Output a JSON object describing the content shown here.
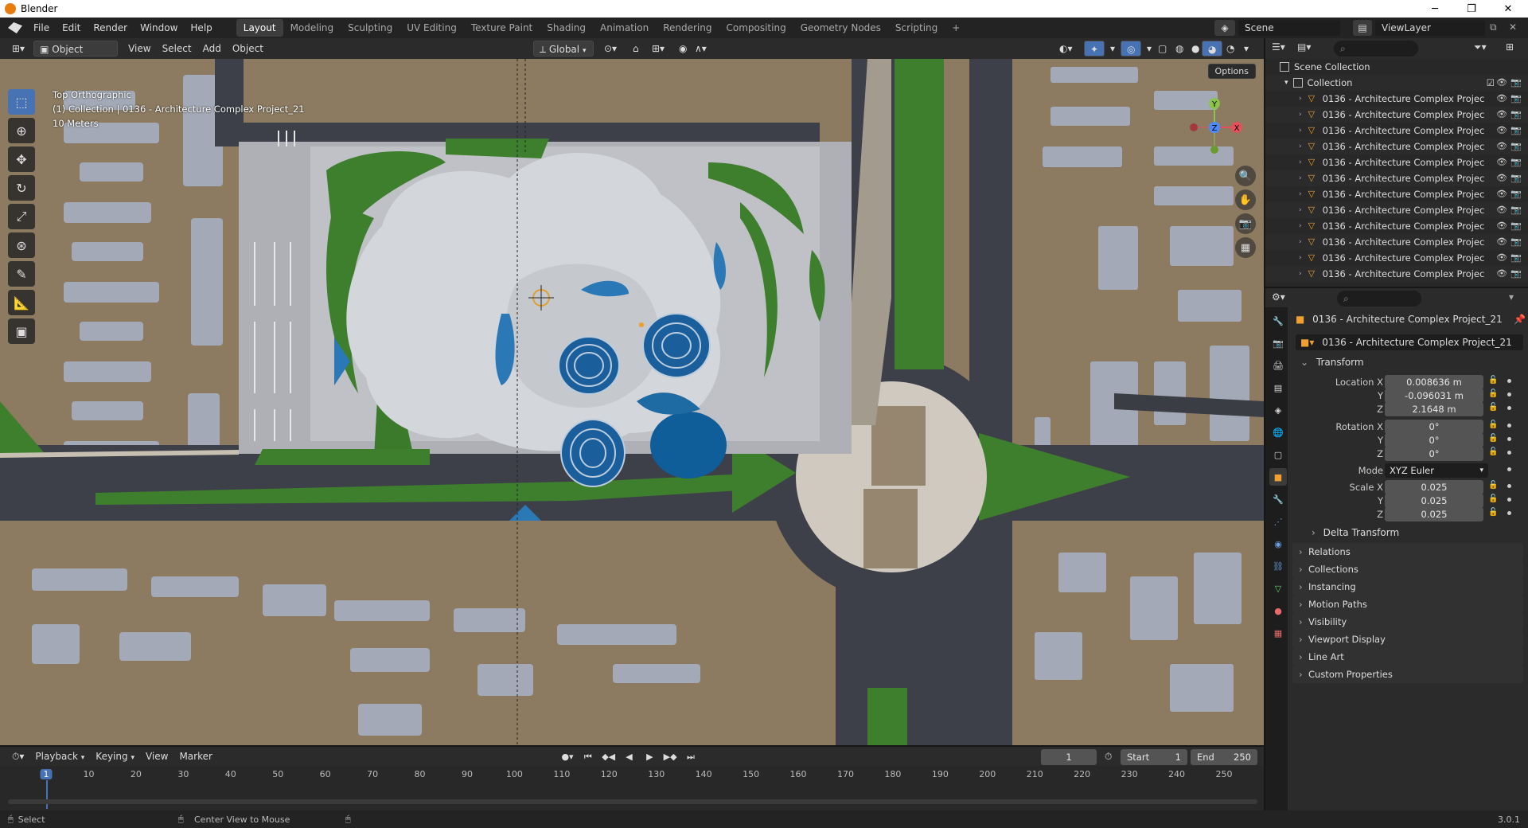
{
  "window": {
    "title": "Blender",
    "min_icon": "minimize-icon",
    "max_icon": "maximize-icon",
    "close_icon": "close-icon"
  },
  "menus": [
    "File",
    "Edit",
    "Render",
    "Window",
    "Help"
  ],
  "workspaces": [
    "Layout",
    "Modeling",
    "Sculpting",
    "UV Editing",
    "Texture Paint",
    "Shading",
    "Animation",
    "Rendering",
    "Compositing",
    "Geometry Nodes",
    "Scripting"
  ],
  "active_workspace": "Layout",
  "add_workspace": "+",
  "scene": {
    "name": "Scene",
    "view_layer": "ViewLayer"
  },
  "viewport_header": {
    "mode": "Object Mode",
    "menus": [
      "View",
      "Select",
      "Add",
      "Object"
    ],
    "transform_orientation": "Global"
  },
  "viewport": {
    "view_name": "Top Orthographic",
    "collection_info": "(1) Collection | 0136 - Architecture Complex Project_21",
    "scale": "10 Meters",
    "options": "Options",
    "gizmo": {
      "y": "Y",
      "z": "Z",
      "x": "X"
    },
    "colors": {
      "ground": "#8a7a62",
      "road": "#3a3d44",
      "grass": "#3a7a2a",
      "plaza": "#b9b9bd",
      "building": "#9aa2b0",
      "water": "#1e6aa3"
    }
  },
  "tools": [
    "select-box-icon",
    "cursor-icon",
    "move-icon",
    "rotate-icon",
    "scale-icon",
    "transform-icon",
    "annotate-icon",
    "measure-icon",
    "add-cube-icon"
  ],
  "outliner": {
    "root": "Scene Collection",
    "collection": "Collection",
    "items": [
      "0136 - Architecture Complex Projec",
      "0136 - Architecture Complex Projec",
      "0136 - Architecture Complex Projec",
      "0136 - Architecture Complex Projec",
      "0136 - Architecture Complex Projec",
      "0136 - Architecture Complex Projec",
      "0136 - Architecture Complex Projec",
      "0136 - Architecture Complex Projec",
      "0136 - Architecture Complex Projec",
      "0136 - Architecture Complex Projec",
      "0136 - Architecture Complex Projec",
      "0136 - Architecture Complex Projec"
    ]
  },
  "properties": {
    "object_name": "0136 - Architecture Complex Project_21",
    "object_field": "0136 - Architecture Complex Project_21",
    "transform_label": "Transform",
    "location": {
      "label": "Location X",
      "x": "0.008636 m",
      "y": "-0.096031 m",
      "z": "2.1648 m"
    },
    "rotation": {
      "label": "Rotation X",
      "x": "0°",
      "y": "0°",
      "z": "0°"
    },
    "mode": {
      "label": "Mode",
      "value": "XYZ Euler"
    },
    "scale": {
      "label": "Scale X",
      "x": "0.025",
      "y": "0.025",
      "z": "0.025"
    },
    "axis_y": "Y",
    "axis_z": "Z",
    "delta": "Delta Transform",
    "panels": [
      "Relations",
      "Collections",
      "Instancing",
      "Motion Paths",
      "Visibility",
      "Viewport Display",
      "Line Art",
      "Custom Properties"
    ]
  },
  "timeline": {
    "menus": [
      "Playback",
      "Keying",
      "View",
      "Marker"
    ],
    "current_frame": "1",
    "start_label": "Start",
    "start": "1",
    "end_label": "End",
    "end": "250",
    "ruler": [
      "1",
      "10",
      "20",
      "30",
      "40",
      "50",
      "60",
      "70",
      "80",
      "90",
      "100",
      "110",
      "120",
      "130",
      "140",
      "150",
      "160",
      "170",
      "180",
      "190",
      "200",
      "210",
      "220",
      "230",
      "240",
      "250"
    ]
  },
  "status": {
    "select": "Select",
    "center_view": "Center View to Mouse",
    "version": "3.0.1"
  }
}
